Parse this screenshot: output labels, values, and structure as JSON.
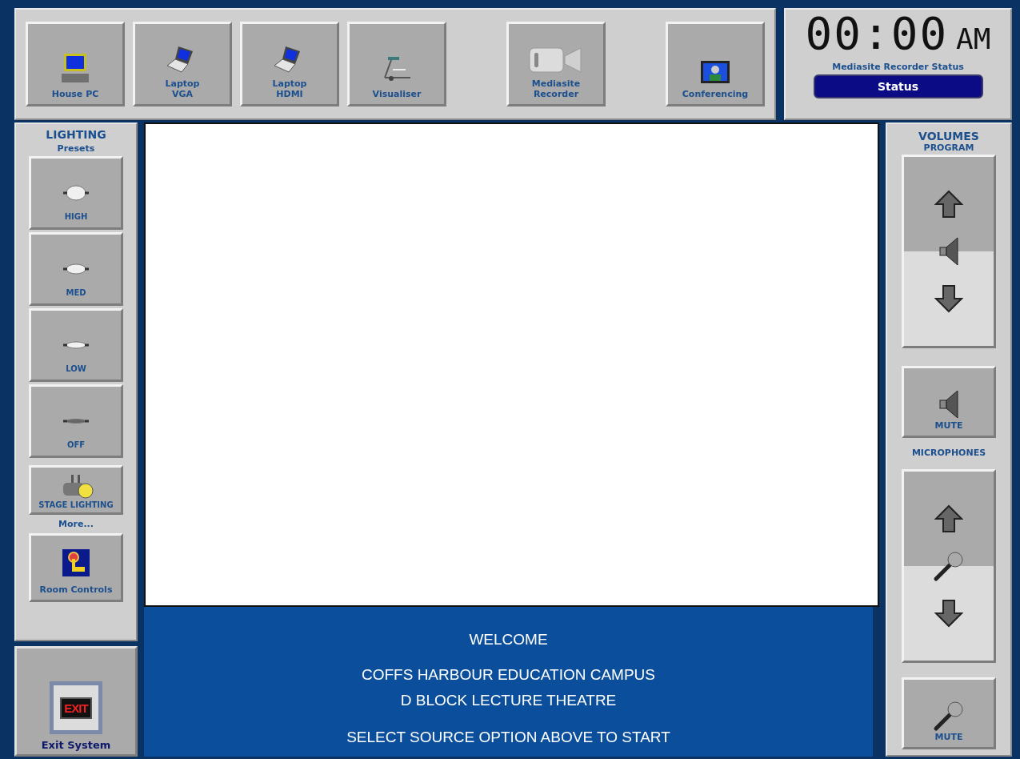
{
  "sources": [
    {
      "lines": [
        "House PC"
      ],
      "kind": "pc"
    },
    {
      "lines": [
        "Laptop",
        "VGA"
      ],
      "kind": "laptop"
    },
    {
      "lines": [
        "Laptop",
        "HDMI"
      ],
      "kind": "laptop"
    },
    {
      "lines": [
        "Visualiser"
      ],
      "kind": "visualiser"
    },
    {
      "lines": [
        "Mediasite",
        "Recorder"
      ],
      "kind": "camera"
    },
    {
      "lines": [
        "Conferencing"
      ],
      "kind": "conferencing"
    }
  ],
  "clock": {
    "time": "00:00",
    "meridiem": "AM",
    "status_label": "Mediasite Recorder Status",
    "status_button": "Status"
  },
  "lighting": {
    "title": "LIGHTING",
    "subtitle": "Presets",
    "presets": [
      {
        "label": "HIGH",
        "kind": "high"
      },
      {
        "label": "MED",
        "kind": "med"
      },
      {
        "label": "LOW",
        "kind": "low"
      },
      {
        "label": "OFF",
        "kind": "off"
      }
    ],
    "stage_button": "STAGE LIGHTING",
    "more": "More...",
    "room_button": "Room Controls"
  },
  "exit": {
    "label": "Exit System",
    "sign": "EXIT"
  },
  "welcome": [
    "WELCOME",
    "COFFS HARBOUR EDUCATION CAMPUS",
    "D BLOCK LECTURE THEATRE",
    "SELECT SOURCE OPTION ABOVE TO START"
  ],
  "volumes": {
    "title": "VOLUMES",
    "groups": [
      {
        "label": "PROGRAM",
        "kind": "speaker",
        "mute": "MUTE"
      },
      {
        "label": "MICROPHONES",
        "kind": "mic",
        "mute": "MUTE"
      }
    ]
  }
}
